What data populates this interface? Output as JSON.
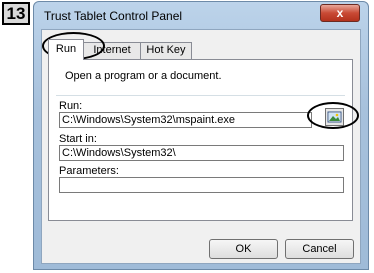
{
  "step_number": "13",
  "window": {
    "title": "Trust Tablet Control Panel",
    "close_glyph": "x"
  },
  "tabs": [
    {
      "label": "Run",
      "active": true
    },
    {
      "label": "Internet",
      "active": false
    },
    {
      "label": "Hot Key",
      "active": false
    }
  ],
  "run_panel": {
    "description": "Open a program or a document.",
    "run_label": "Run:",
    "run_value": "C:\\Windows\\System32\\mspaint.exe",
    "start_in_label": "Start in:",
    "start_in_value": "C:\\Windows\\System32\\",
    "parameters_label": "Parameters:",
    "parameters_value": ""
  },
  "buttons": {
    "ok": "OK",
    "cancel": "Cancel"
  }
}
